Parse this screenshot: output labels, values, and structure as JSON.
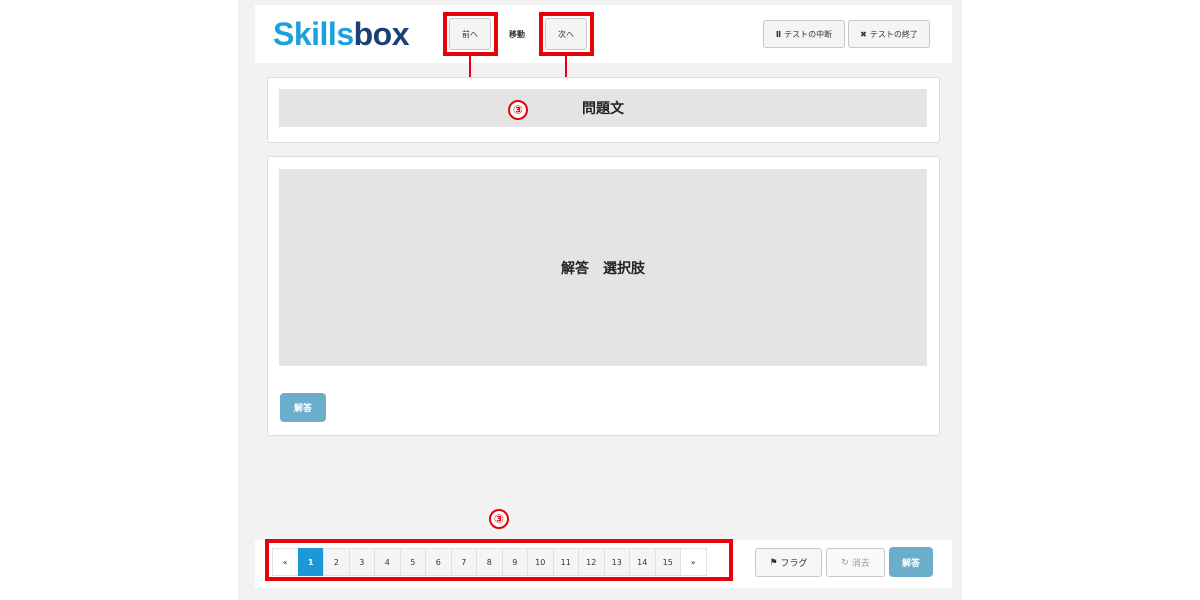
{
  "logo": {
    "part1": "Skills",
    "part2": "box"
  },
  "nav": {
    "prev": "前へ",
    "move": "移動",
    "next": "次へ"
  },
  "test": {
    "pause": "テストの中断",
    "end": "テストの終了"
  },
  "annotation": {
    "marker": "③"
  },
  "question": {
    "label": "問題文"
  },
  "choices": {
    "label": "解答　選択肢"
  },
  "answer_button": "解答",
  "pagination": {
    "prev": "«",
    "pages": [
      "1",
      "2",
      "3",
      "4",
      "5",
      "6",
      "7",
      "8",
      "9",
      "10",
      "11",
      "12",
      "13",
      "14",
      "15"
    ],
    "next": "»",
    "active_page": "1"
  },
  "footer": {
    "flag": "フラグ",
    "clear": "消去",
    "answer": "解答"
  },
  "colors": {
    "accent": "#1d98d6",
    "annotation_red": "#e8000b",
    "answer_btn": "#6aaecb"
  }
}
